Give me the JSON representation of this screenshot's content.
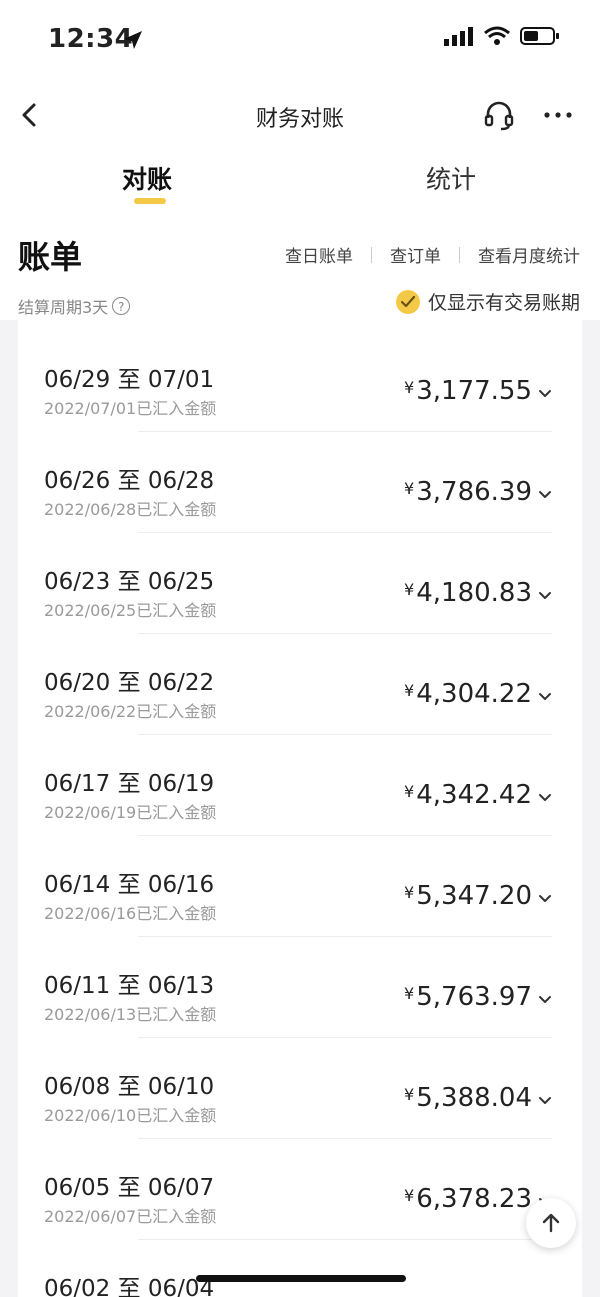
{
  "status_bar": {
    "time": "12:34"
  },
  "nav": {
    "title": "财务对账"
  },
  "tabs": [
    {
      "label": "对账",
      "active": true
    },
    {
      "label": "统计",
      "active": false
    }
  ],
  "bill": {
    "title": "账单",
    "links": [
      "查日账单",
      "查订单",
      "查看月度统计"
    ],
    "period_text": "结算周期3天",
    "filter_label": "仅显示有交易账期"
  },
  "currency_symbol": "¥",
  "rows": [
    {
      "range": "06/29 至 07/01",
      "sub": "2022/07/01已汇入金额",
      "amount": "3,177.55"
    },
    {
      "range": "06/26 至 06/28",
      "sub": "2022/06/28已汇入金额",
      "amount": "3,786.39"
    },
    {
      "range": "06/23 至 06/25",
      "sub": "2022/06/25已汇入金额",
      "amount": "4,180.83"
    },
    {
      "range": "06/20 至 06/22",
      "sub": "2022/06/22已汇入金额",
      "amount": "4,304.22"
    },
    {
      "range": "06/17 至 06/19",
      "sub": "2022/06/19已汇入金额",
      "amount": "4,342.42"
    },
    {
      "range": "06/14 至 06/16",
      "sub": "2022/06/16已汇入金额",
      "amount": "5,347.20"
    },
    {
      "range": "06/11 至 06/13",
      "sub": "2022/06/13已汇入金额",
      "amount": "5,763.97"
    },
    {
      "range": "06/08 至 06/10",
      "sub": "2022/06/10已汇入金额",
      "amount": "5,388.04"
    },
    {
      "range": "06/05 至 06/07",
      "sub": "2022/06/07已汇入金额",
      "amount": "6,378.23"
    },
    {
      "range": "06/02 至 06/04",
      "sub": "",
      "amount": ""
    }
  ],
  "colors": {
    "accent": "#f5c948",
    "background": "#f3f3f5"
  }
}
